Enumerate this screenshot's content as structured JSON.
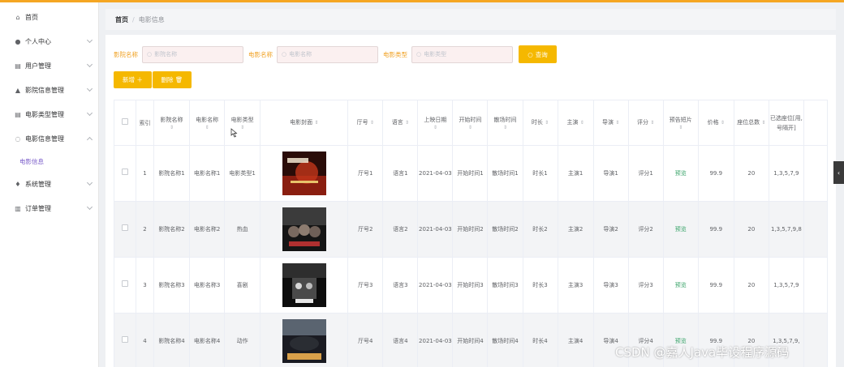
{
  "sidebar": {
    "items": [
      {
        "icon": "home-icon",
        "glyph": "⌂",
        "label": "首页",
        "chevron": false
      },
      {
        "icon": "user-icon",
        "glyph": "●",
        "label": "个人中心",
        "chevron": true
      },
      {
        "icon": "doc-icon",
        "glyph": "▤",
        "label": "用户管理",
        "chevron": true
      },
      {
        "icon": "chart-icon",
        "glyph": "▲",
        "label": "影院信息管理",
        "chevron": true
      },
      {
        "icon": "doc-icon",
        "glyph": "▤",
        "label": "电影类型管理",
        "chevron": true
      },
      {
        "icon": "power-icon",
        "glyph": "◌",
        "label": "电影信息管理",
        "chevron": true,
        "expanded": true
      }
    ],
    "subitem": "电影信息",
    "items2": [
      {
        "icon": "mic-icon",
        "glyph": "♦",
        "label": "系统管理",
        "chevron": true
      },
      {
        "icon": "bank-icon",
        "glyph": "▥",
        "label": "订单管理",
        "chevron": true
      }
    ]
  },
  "breadcrumb": {
    "home": "首页",
    "separator": "/",
    "current": "电影信息"
  },
  "filters": {
    "cinema_label": "影院名称",
    "cinema_placeholder": "影院名称",
    "movie_label": "电影名称",
    "movie_placeholder": "电影名称",
    "type_label": "电影类型",
    "type_placeholder": "电影类型",
    "query_label": "查询"
  },
  "actions": {
    "add_label": "新增 ＋",
    "delete_label": "删除 🗑"
  },
  "table": {
    "headers": [
      "索引",
      "影院名称",
      "电影名称",
      "电影类型",
      "电影封面",
      "厅号",
      "语言",
      "上映日期",
      "开始时间",
      "散场时间",
      "时长",
      "主演",
      "导演",
      "评分",
      "预告短片",
      "价格",
      "座位总数",
      "已选座位[用,号隔开]"
    ],
    "rows": [
      {
        "index": "1",
        "cinema": "影院名称1",
        "movie": "电影名称1",
        "type": "电影类型1",
        "hall": "厅号1",
        "lang": "语言1",
        "date": "2021-04-03",
        "start": "开始时间1",
        "end": "散场时间1",
        "dur": "时长1",
        "actor": "主演1",
        "director": "导演1",
        "score": "评分1",
        "trailer": "预览",
        "price": "99.9",
        "seats": "20",
        "chosen": "1,3,5,7,9"
      },
      {
        "index": "2",
        "cinema": "影院名称2",
        "movie": "电影名称2",
        "type": "热血",
        "hall": "厅号2",
        "lang": "语言2",
        "date": "2021-04-03",
        "start": "开始时间2",
        "end": "散场时间2",
        "dur": "时长2",
        "actor": "主演2",
        "director": "导演2",
        "score": "评分2",
        "trailer": "预览",
        "price": "99.9",
        "seats": "20",
        "chosen": "1,3,5,7,9,8"
      },
      {
        "index": "3",
        "cinema": "影院名称3",
        "movie": "电影名称3",
        "type": "喜剧",
        "hall": "厅号3",
        "lang": "语言3",
        "date": "2021-04-03",
        "start": "开始时间3",
        "end": "散场时间3",
        "dur": "时长3",
        "actor": "主演3",
        "director": "导演3",
        "score": "评分3",
        "trailer": "预览",
        "price": "99.9",
        "seats": "20",
        "chosen": "1,3,5,7,9"
      },
      {
        "index": "4",
        "cinema": "影院名称4",
        "movie": "电影名称4",
        "type": "动作",
        "hall": "厅号4",
        "lang": "语言4",
        "date": "2021-04-03",
        "start": "开始时间4",
        "end": "散场时间4",
        "dur": "时长4",
        "actor": "主演4",
        "director": "导演4",
        "score": "评分4",
        "trailer": "预览",
        "price": "99.9",
        "seats": "20",
        "chosen": "1,3,5,7,9,"
      }
    ]
  },
  "watermark": "CSDN @嘉人Java毕设程序源码",
  "colors": {
    "accent": "#f5b800",
    "active_sub": "#7a5cc9",
    "link": "#3aa46a"
  }
}
